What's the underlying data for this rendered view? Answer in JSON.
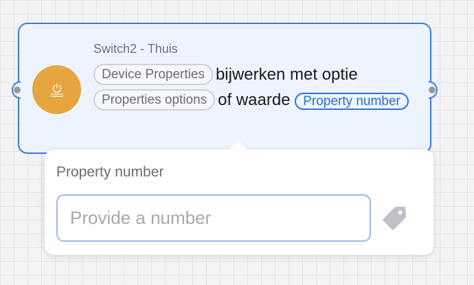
{
  "card": {
    "title": "Switch2 - Thuis",
    "token_device": "Device Properties",
    "text_1": "bijwerken met optie",
    "token_options": "Properties options",
    "text_2": "of waarde",
    "token_number": "Property number",
    "icon": "power-device-icon",
    "accent_color": "#e6a53f",
    "border_color": "#3a7ce0"
  },
  "popup": {
    "label": "Property number",
    "placeholder": "Provide a number",
    "value": "",
    "tag_icon": "tag-icon"
  }
}
